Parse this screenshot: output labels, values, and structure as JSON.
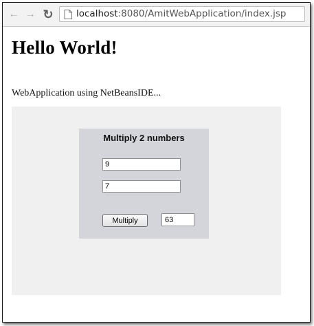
{
  "browser": {
    "url_host": "localhost",
    "url_path": ":8080/AmitWebApplication/index.jsp",
    "icons": {
      "back": "arrow-left-icon",
      "forward": "arrow-right-icon",
      "reload": "reload-icon",
      "page": "page-icon"
    }
  },
  "page": {
    "heading": "Hello World!",
    "subtitle": "WebApplication using NetBeansIDE..."
  },
  "form": {
    "title": "Multiply 2 numbers",
    "number1": "9",
    "number2": "7",
    "button_label": "Multiply",
    "result": "63"
  },
  "colors": {
    "outer_panel": "#f0f0f1",
    "form_box": "#d3d5da"
  }
}
